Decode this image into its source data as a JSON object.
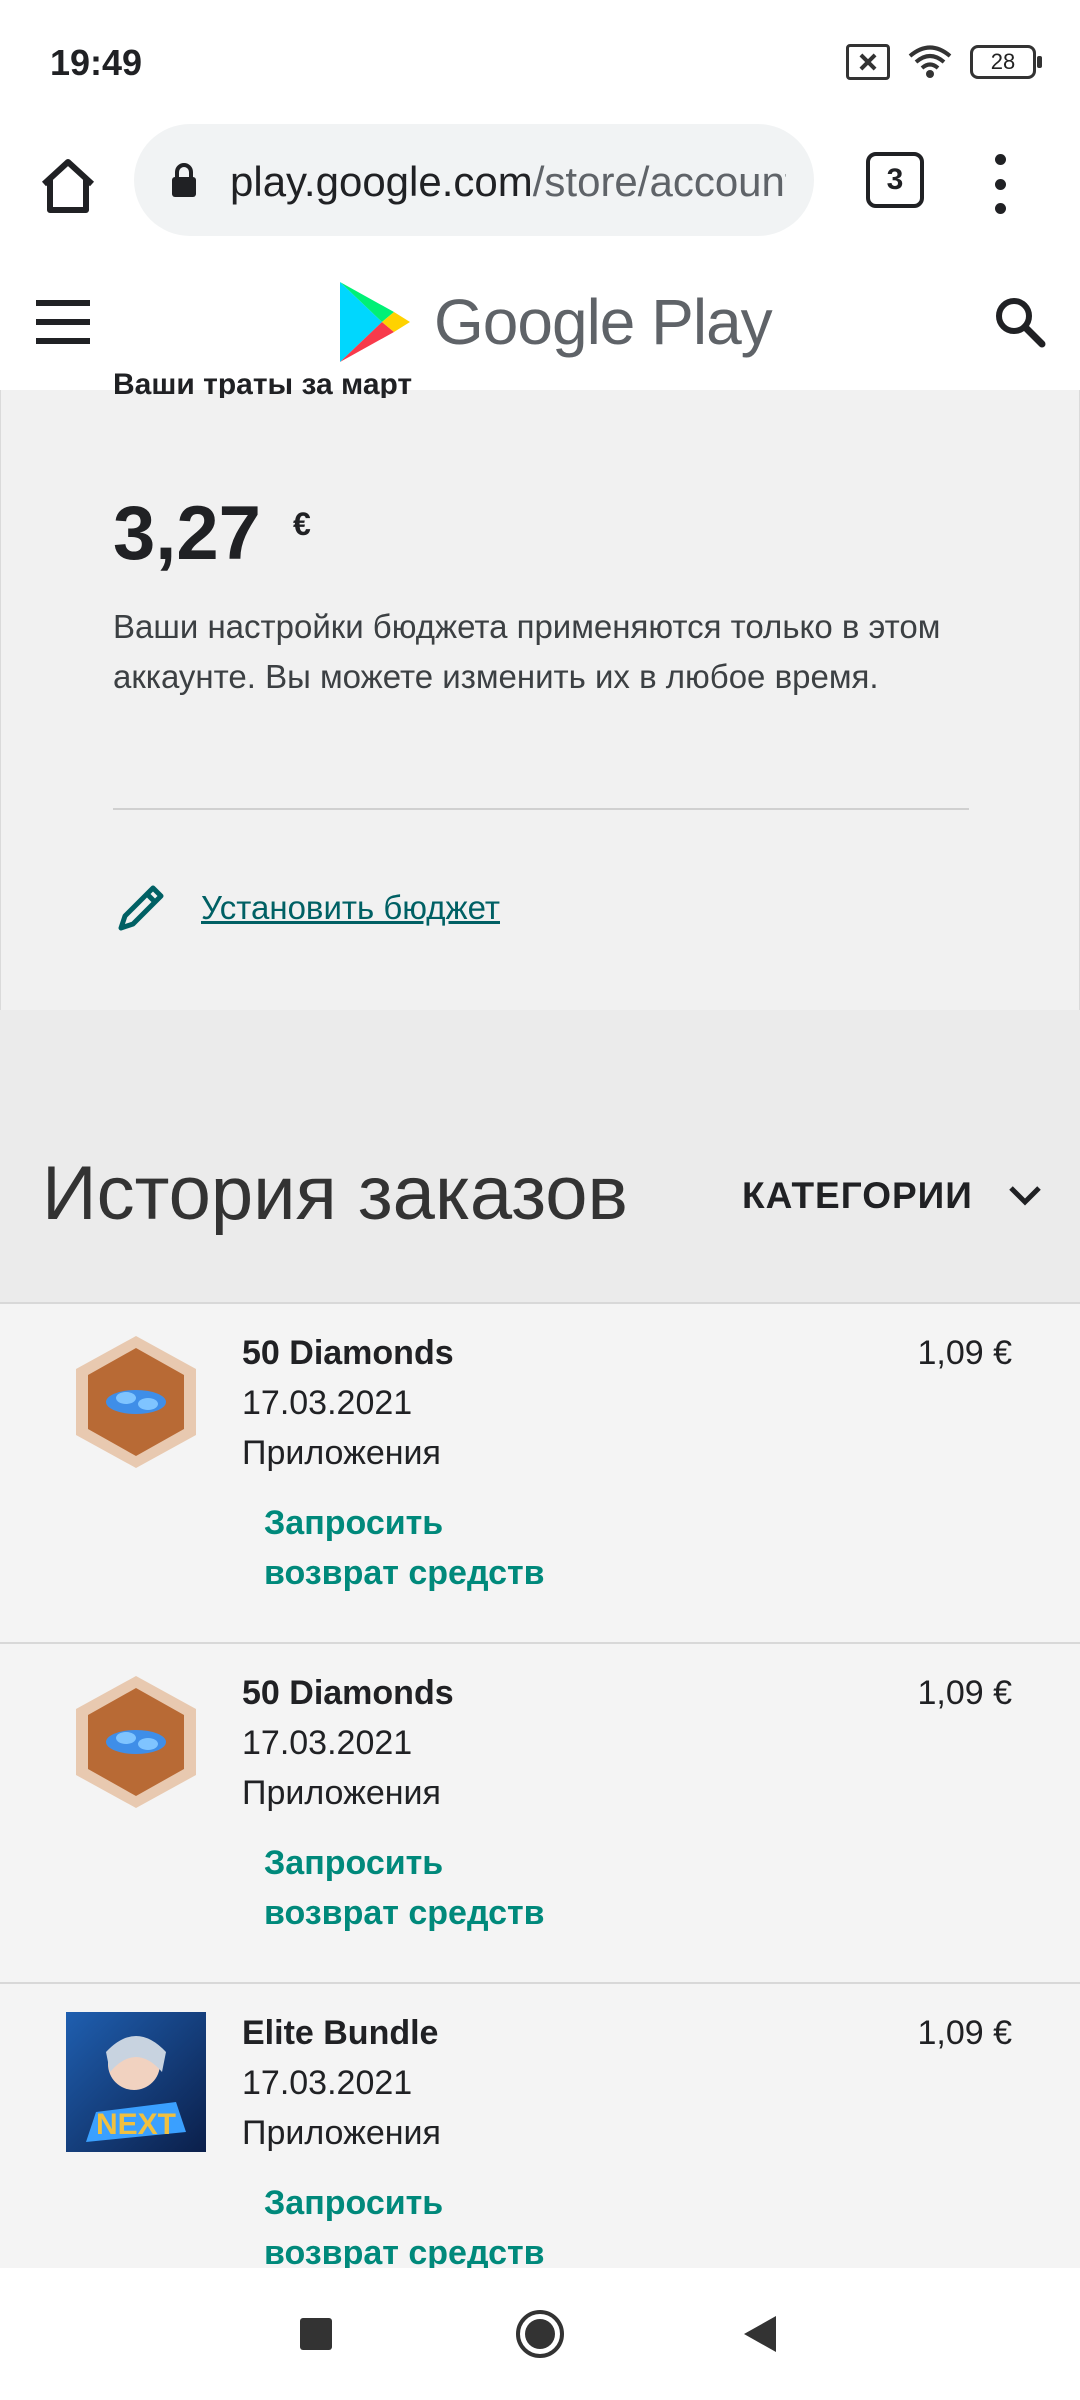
{
  "status_bar": {
    "time": "19:49",
    "battery": "28",
    "icons": [
      "sim-off-icon",
      "wifi-icon",
      "battery-icon"
    ]
  },
  "browser": {
    "url_host": "play.google.com",
    "url_path": "/store/account",
    "tab_count": "3"
  },
  "header": {
    "logo_text": "Google Play"
  },
  "budget": {
    "partial_title": "Ваши траты за март",
    "amount": "3,27",
    "currency": "€",
    "description": "Ваши настройки бюджета применяются только в этом аккаунте. Вы можете изменить их в любое время.",
    "set_budget_label": "Установить бюджет"
  },
  "history": {
    "title": "История заказов",
    "categories_label": "КАТЕГОРИИ"
  },
  "orders": [
    {
      "name": "50 Diamonds",
      "date": "17.03.2021",
      "category": "Приложения",
      "price": "1,09 €",
      "refund_label": "Запросить возврат средств"
    },
    {
      "name": "50 Diamonds",
      "date": "17.03.2021",
      "category": "Приложения",
      "price": "1,09 €",
      "refund_label": "Запросить возврат средств"
    },
    {
      "name": "Elite Bundle",
      "date": "17.03.2021",
      "category": "Приложения",
      "price": "1,09 €",
      "refund_label": "Запросить возврат средств"
    }
  ],
  "colors": {
    "link": "#006064",
    "refund": "#00897b",
    "card_bg": "#f1f1f1"
  }
}
